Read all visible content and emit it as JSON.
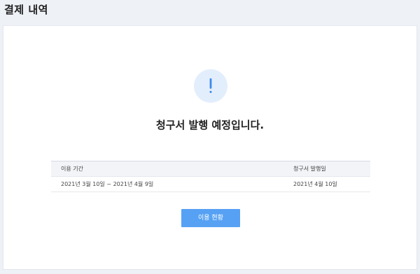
{
  "page": {
    "title": "결제 내역"
  },
  "alert": {
    "icon": "exclamation-icon",
    "symbol": "!",
    "color": "#3d8be9",
    "message": "청구서 발행 예정입니다."
  },
  "table": {
    "columns": [
      "이용 기간",
      "청구서 발행일"
    ],
    "rows": [
      [
        "2021년 3월 10일 ~ 2021년 4월 9일",
        "2021년 4월 10일"
      ]
    ]
  },
  "actions": {
    "usage_button_label": "이용 현황"
  },
  "colors": {
    "page_bg": "#eef1f6",
    "button_bg": "#56a1f4",
    "icon_circle_bg": "#e3eefc"
  }
}
